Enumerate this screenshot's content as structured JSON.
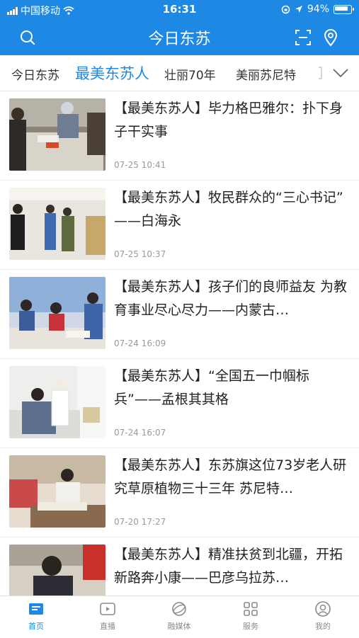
{
  "status_bar": {
    "carrier": "中国移动",
    "time": "16:31",
    "battery": "94%"
  },
  "header": {
    "title": "今日东苏"
  },
  "tabs": [
    {
      "label": "今日东苏",
      "active": false
    },
    {
      "label": "最美东苏人",
      "active": true
    },
    {
      "label": "壮丽70年",
      "active": false
    },
    {
      "label": "美丽苏尼特",
      "active": false
    }
  ],
  "news": [
    {
      "title": "【最美东苏人】毕力格巴雅尔：扑下身子干实事",
      "time": "07-25 10:41"
    },
    {
      "title": "【最美东苏人】牧民群众的“三心书记” ——白海永",
      "time": "07-25 10:37"
    },
    {
      "title": "【最美东苏人】孩子们的良师益友 为教育事业尽心尽力——内蒙古…",
      "time": "07-24 16:09"
    },
    {
      "title": "【最美东苏人】“全国五一巾帼标兵”——孟根其其格",
      "time": "07-24 16:07"
    },
    {
      "title": "【最美东苏人】东苏旗这位73岁老人研究草原植物三十三年 苏尼特…",
      "time": "07-20 17:27"
    },
    {
      "title": "【最美东苏人】精准扶贫到北疆，开拓新路奔小康——巴彦乌拉苏…",
      "time": ""
    }
  ],
  "bottom_nav": [
    {
      "label": "首页",
      "icon": "home-icon",
      "active": true
    },
    {
      "label": "直播",
      "icon": "live-icon",
      "active": false
    },
    {
      "label": "融媒体",
      "icon": "media-icon",
      "active": false
    },
    {
      "label": "服务",
      "icon": "service-icon",
      "active": false
    },
    {
      "label": "我的",
      "icon": "profile-icon",
      "active": false
    }
  ],
  "colors": {
    "primary": "#1e88e5",
    "text": "#222222",
    "muted": "#9a9a9a"
  }
}
